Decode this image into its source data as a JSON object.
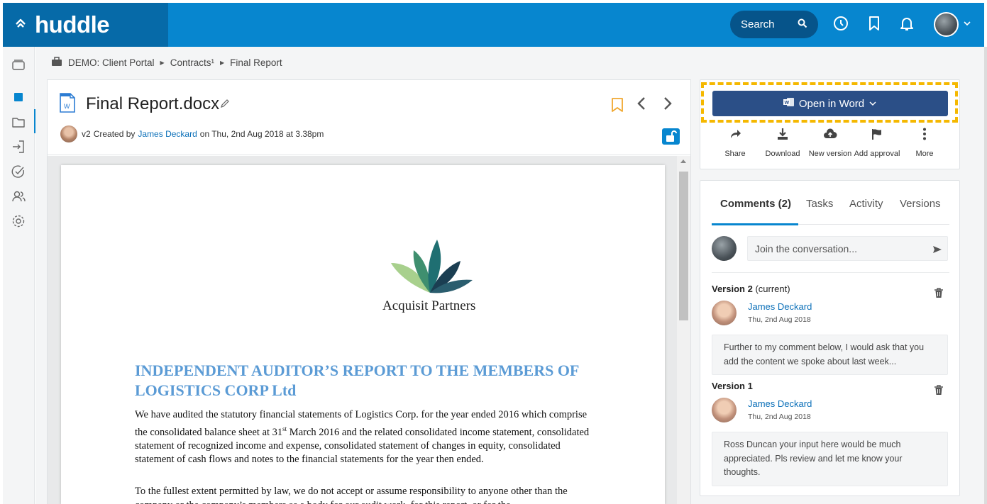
{
  "topbar": {
    "logo": "huddle",
    "search_label": "Search",
    "icons": [
      "home-icon",
      "search-icon",
      "clock-icon",
      "bookmark-icon",
      "bell-icon",
      "chevron-down-icon"
    ]
  },
  "rail": {
    "items": [
      "workspaces-icon",
      "overview-icon",
      "files-icon",
      "sign-in-icon",
      "tasks-icon",
      "people-icon",
      "settings-icon"
    ]
  },
  "breadcrumb": {
    "items": [
      "DEMO: Client Portal",
      "Contracts¹",
      "Final Report"
    ]
  },
  "document": {
    "title": "Final Report.docx",
    "version": "v2",
    "created_by_prefix": "Created by",
    "author": "James Deckard",
    "created_on": "on Thu, 2nd Aug 2018 at 3.38pm"
  },
  "page_content": {
    "company_name": "Acquisit Partners",
    "heading": "INDEPENDENT AUDITOR’S REPORT TO THE MEMBERS OF LOGISTICS CORP Ltd",
    "para1_a": "We have audited the statutory financial statements of Logistics Corp. for the year ended 2016 which comprise the consolidated balance sheet at 31",
    "para1_sup": "st",
    "para1_b": " March 2016 and the related consolidated income statement, consolidated statement of recognized income and expense, consolidated statement of changes in equity, consolidated statement of cash flows and notes to the financial statements for the year then ended.",
    "para2": "To the fullest extent permitted by law, we do not accept or assume responsibility to anyone other than the company or the company’s members as a body for our audit work, for this report, or for the"
  },
  "actions": {
    "open_in_word": "Open in Word",
    "share": "Share",
    "download": "Download",
    "new_version": "New version",
    "add_approval": "Add approval",
    "more": "More"
  },
  "comments_panel": {
    "tabs": [
      "Comments (2)",
      "Tasks",
      "Activity",
      "Versions"
    ],
    "active_tab": "Comments (2)",
    "placeholder": "Join the conversation...",
    "comments": [
      {
        "version": "Version 2",
        "version_note": "(current)",
        "author": "James Deckard",
        "date": "Thu, 2nd Aug 2018",
        "text": "Further to my comment below, I would ask that you add the content we spoke about last week..."
      },
      {
        "version": "Version 1",
        "version_note": "",
        "author": "James Deckard",
        "date": "Thu, 2nd Aug 2018",
        "text": "Ross Duncan your input here would be much appreciated. Pls review and let me know your thoughts."
      }
    ]
  },
  "colors": {
    "brand_blue": "#0786cf",
    "brand_dark": "#066aa8",
    "word_button": "#2b4f87",
    "highlight": "#f5b800",
    "heading_blue": "#5b9bd5"
  }
}
